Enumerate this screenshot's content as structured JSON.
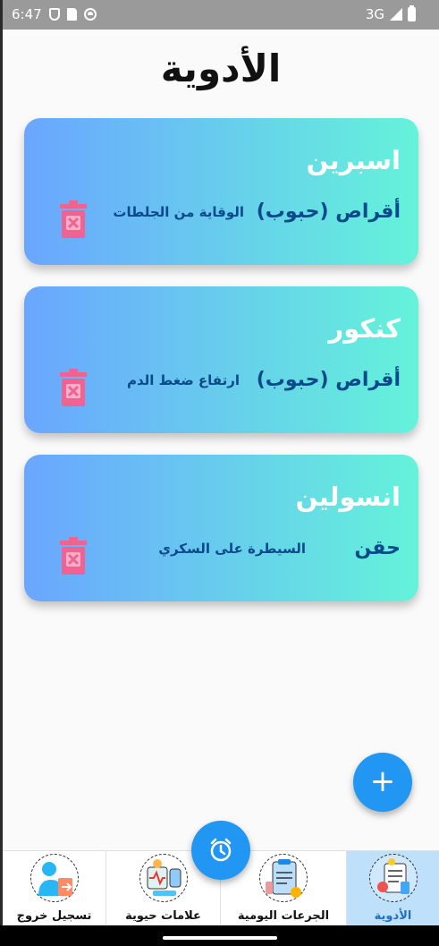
{
  "status_bar": {
    "time": "6:47",
    "network": "3G"
  },
  "page": {
    "title": "الأدوية"
  },
  "medications": [
    {
      "name": "اسبرين",
      "form": "أقراص (حبوب)",
      "purpose": "الوقاية من الجلطات"
    },
    {
      "name": "كنكور",
      "form": "أقراص (حبوب)",
      "purpose": "ارتفاع ضغط الدم"
    },
    {
      "name": "انسولين",
      "form": "حقن",
      "purpose": "السيطرة على السكري"
    }
  ],
  "fab": {
    "add_icon": "plus-icon",
    "add_label": "+",
    "alarm_icon": "alarm-clock-icon"
  },
  "bottom_nav": [
    {
      "label": "تسجيل خروج",
      "icon": "logout-icon"
    },
    {
      "label": "علامات حيوية",
      "icon": "vital-signs-icon"
    },
    {
      "label": "الجرعات اليومية",
      "icon": "daily-doses-icon"
    },
    {
      "label": "الأدوية",
      "icon": "medications-icon",
      "active": true
    }
  ],
  "colors": {
    "accent": "#2196f3",
    "card_start": "#6aa6ff",
    "card_end": "#64f3da",
    "trash": "#f06292",
    "text_dark_blue": "#0b4a8a",
    "active_nav_bg": "#bfe0fb"
  }
}
